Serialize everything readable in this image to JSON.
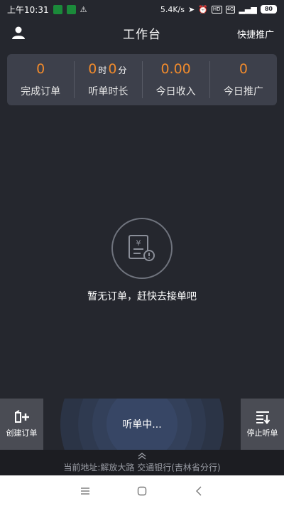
{
  "status_bar": {
    "time": "上午10:31",
    "network_speed": "5.4K/s",
    "hd_label": "HD",
    "signal_label": "4G",
    "battery": "80"
  },
  "header": {
    "title": "工作台",
    "action": "快捷推广"
  },
  "stats": [
    {
      "value": "0",
      "label": "完成订单"
    },
    {
      "hours": "0",
      "hours_unit": "时",
      "minutes": "0",
      "minutes_unit": "分",
      "label": "听单时长"
    },
    {
      "value": "0.00",
      "label": "今日收入"
    },
    {
      "value": "0",
      "label": "今日推广"
    }
  ],
  "empty_state": {
    "message": "暂无订单，赶快去接单吧",
    "icon_glyph": "¥"
  },
  "bottom": {
    "create_order": "创建订单",
    "listening": "听单中...",
    "stop_listening": "停止听单"
  },
  "address": {
    "text": "当前地址:解放大路 交通银行(吉林省分行)"
  },
  "colors": {
    "accent": "#f08a2c",
    "background": "#25272e",
    "card": "#3d404b"
  },
  "icons": {
    "user": "user-icon",
    "create": "create-order-icon",
    "stop": "stop-listening-icon",
    "chevron": "chevron-up-icon",
    "empty": "empty-order-icon"
  }
}
